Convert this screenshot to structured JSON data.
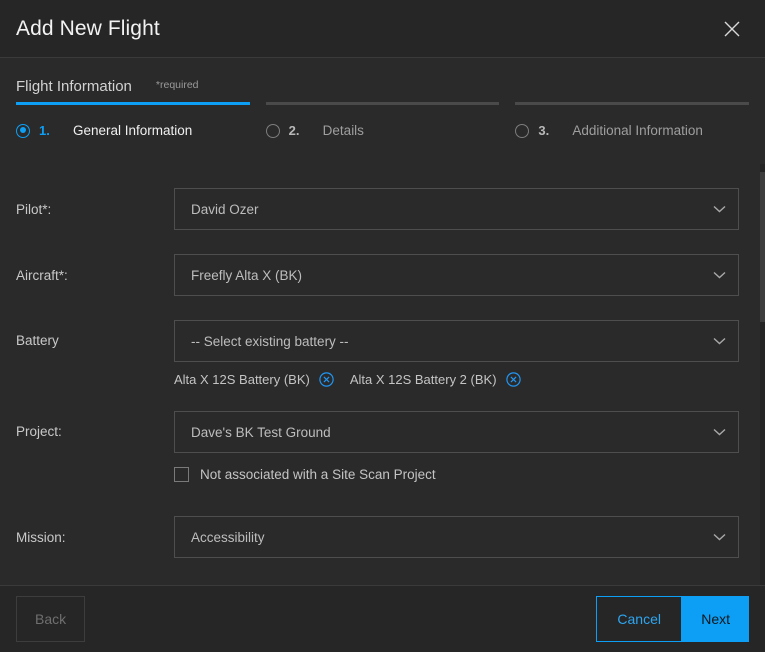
{
  "header": {
    "title": "Add New Flight",
    "close_icon": "close-icon"
  },
  "section": {
    "title": "Flight Information",
    "required_note": "*required"
  },
  "stepper": {
    "steps": [
      {
        "num": "1.",
        "label": "General Information",
        "active": true
      },
      {
        "num": "2.",
        "label": "Details",
        "active": false
      },
      {
        "num": "3.",
        "label": "Additional Information",
        "active": false
      }
    ]
  },
  "form": {
    "pilot": {
      "label": "Pilot*:",
      "value": "David Ozer"
    },
    "aircraft": {
      "label": "Aircraft*:",
      "value": "Freefly Alta X (BK)"
    },
    "battery": {
      "label": "Battery",
      "value": "-- Select existing battery --",
      "chips": [
        "Alta X 12S Battery (BK)",
        "Alta X 12S Battery 2 (BK)"
      ]
    },
    "project": {
      "label": "Project:",
      "value": "Dave's BK Test Ground",
      "checkbox_label": "Not associated with a Site Scan Project",
      "checkbox_checked": false
    },
    "mission": {
      "label": "Mission:",
      "value": "Accessibility"
    }
  },
  "footer": {
    "back": "Back",
    "cancel": "Cancel",
    "next": "Next"
  },
  "colors": {
    "accent": "#0d9ff5",
    "background": "#2a2a2a",
    "header_background": "#262626",
    "text_primary": "#f2f2f2",
    "text_secondary": "#bdbdbd"
  }
}
